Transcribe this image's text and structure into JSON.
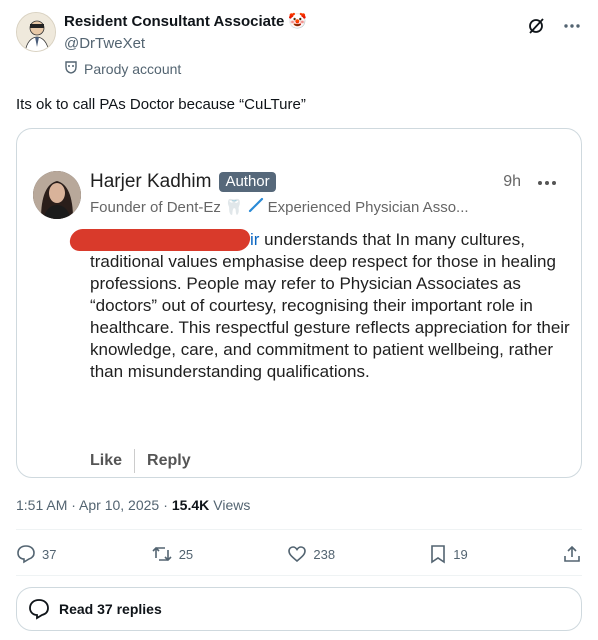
{
  "post": {
    "display_name": "Resident Consultant Associate",
    "name_emoji": "🤡",
    "handle": "@DrTweXet",
    "parody_label": "Parody account",
    "text": "Its ok to call PAs Doctor because “CuLTure”",
    "timestamp": "1:51 AM · Apr 10, 2025",
    "dot": "·",
    "views_count": "15.4K",
    "views_label": "Views"
  },
  "quote": {
    "name": "Harjer Kadhim",
    "badge": "Author",
    "time": "9h",
    "headline_start": "Founder of Dent-Ez",
    "headline_end": "Experienced Physician Asso...",
    "tooth_emoji": "🦷",
    "body_blue": "ir",
    "body_rest": " understands that In many cultures, traditional values emphasise deep respect for those in healing professions. People may refer to Physician Associates as “doctors” out of courtesy, recognising their important role in healthcare. This respectful gesture reflects appreciation for their knowledge, care, and commitment to patient wellbeing, rather than misunderstanding qualifications.",
    "like_label": "Like",
    "reply_label": "Reply",
    "link_color": "#0a66c2",
    "redaction_color": "#d93a2b"
  },
  "actions": {
    "replies": "37",
    "reposts": "25",
    "likes": "238",
    "bookmarks": "19"
  },
  "footer": {
    "read_replies": "Read 37 replies"
  }
}
